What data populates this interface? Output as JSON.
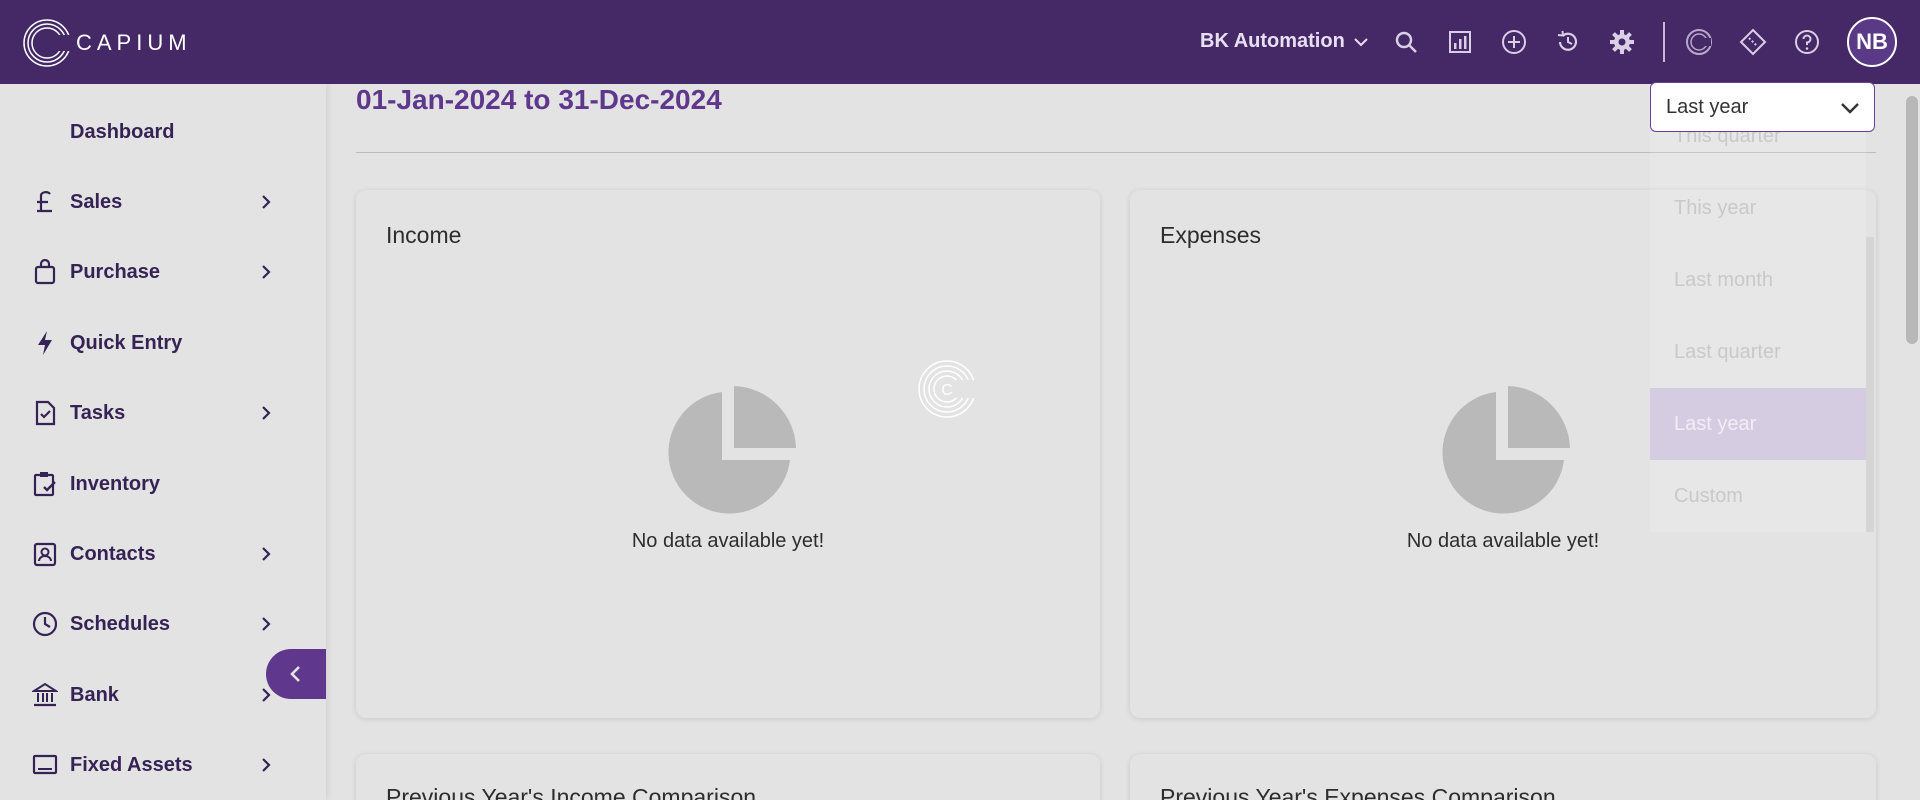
{
  "brand": {
    "name": "CAPIUM"
  },
  "header": {
    "org_name": "BK Automation",
    "icons": [
      "search-icon",
      "reports-icon",
      "add-icon",
      "history-icon",
      "settings-icon",
      "capium-apps-icon",
      "ticket-icon",
      "help-icon"
    ],
    "avatar_initials": "NB"
  },
  "sidebar": {
    "items": [
      {
        "label": "Dashboard",
        "icon": "dashboard-icon",
        "has_children": false
      },
      {
        "label": "Sales",
        "icon": "pound-icon",
        "has_children": true
      },
      {
        "label": "Purchase",
        "icon": "shopping-bag-icon",
        "has_children": true
      },
      {
        "label": "Quick Entry",
        "icon": "bolt-icon",
        "has_children": false
      },
      {
        "label": "Tasks",
        "icon": "task-icon",
        "has_children": true
      },
      {
        "label": "Inventory",
        "icon": "clipboard-check-icon",
        "has_children": false
      },
      {
        "label": "Contacts",
        "icon": "contact-card-icon",
        "has_children": true
      },
      {
        "label": "Schedules",
        "icon": "clock-icon",
        "has_children": true
      },
      {
        "label": "Bank",
        "icon": "bank-icon",
        "has_children": true
      },
      {
        "label": "Fixed Assets",
        "icon": "monitor-icon",
        "has_children": true
      }
    ]
  },
  "main": {
    "date_range": "01-Jan-2024 to 31-Dec-2024",
    "cards": [
      {
        "title": "Income",
        "empty_text": "No data available yet!"
      },
      {
        "title": "Expenses",
        "empty_text": "No data available yet!"
      },
      {
        "title": "Previous Year's Income Comparison"
      },
      {
        "title": "Previous Year's Expenses Comparison"
      }
    ]
  },
  "period_select": {
    "selected": "Last year",
    "options": [
      "This quarter",
      "This year",
      "Last month",
      "Last quarter",
      "Last year",
      "Custom"
    ]
  },
  "colors": {
    "header_bg": "#452866",
    "accent": "#6b3fa0",
    "selected_option_bg": "#d6cce1"
  }
}
